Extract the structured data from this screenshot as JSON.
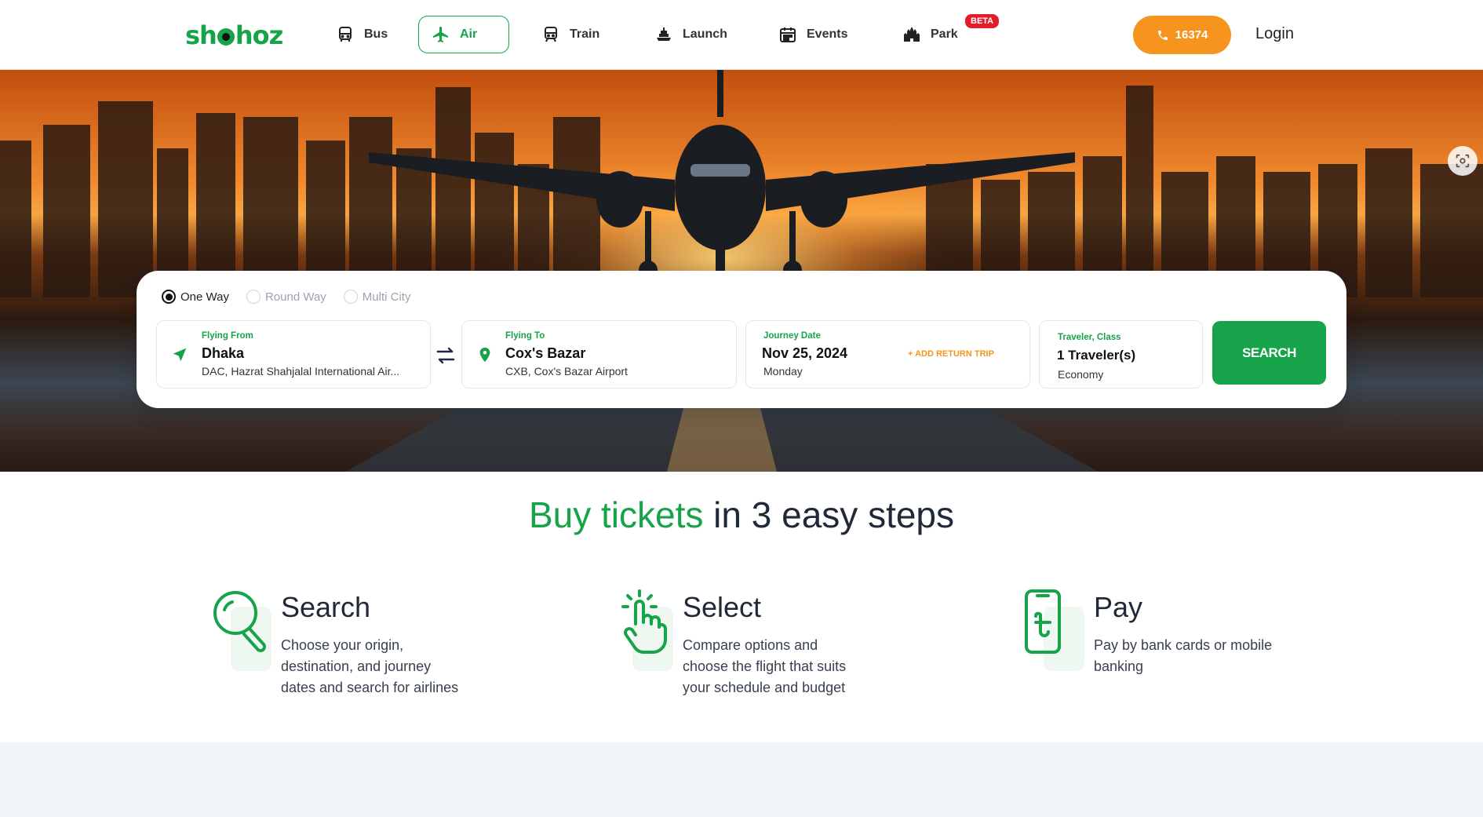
{
  "brand": {
    "logo_pre": "sh",
    "logo_post": "hoz",
    "accent": "#16a34a",
    "orange": "#f7941d"
  },
  "nav": {
    "bus": "Bus",
    "air": "Air",
    "train": "Train",
    "launch": "Launch",
    "events": "Events",
    "park": "Park",
    "beta": "BETA"
  },
  "header": {
    "hotline": "16374",
    "login": "Login"
  },
  "search": {
    "trip_types": [
      "One Way",
      "Round Way",
      "Multi City"
    ],
    "selected_trip": "One Way",
    "from": {
      "label": "Flying From",
      "city": "Dhaka",
      "airport": "DAC, Hazrat Shahjalal International Air..."
    },
    "to": {
      "label": "Flying To",
      "city": "Cox's Bazar",
      "airport": "CXB, Cox's Bazar Airport"
    },
    "date": {
      "label": "Journey Date",
      "value": "Nov 25, 2024",
      "day": "Monday",
      "return_link": "+ ADD RETURN TRIP"
    },
    "traveler": {
      "label": "Traveler, Class",
      "count": "1 Traveler(s)",
      "class": "Economy"
    },
    "button": "SEARCH"
  },
  "steps": {
    "title_green": "Buy tickets",
    "title_rest": " in 3 easy steps",
    "items": [
      {
        "title": "Search",
        "desc": "Choose your origin, destination, and journey dates and search for airlines",
        "icon": "magnifier-icon"
      },
      {
        "title": "Select",
        "desc": "Compare options and choose the flight that suits your schedule and budget",
        "icon": "tap-hand-icon"
      },
      {
        "title": "Pay",
        "desc": "Pay by bank cards or mobile banking",
        "icon": "phone-taka-icon"
      }
    ]
  }
}
